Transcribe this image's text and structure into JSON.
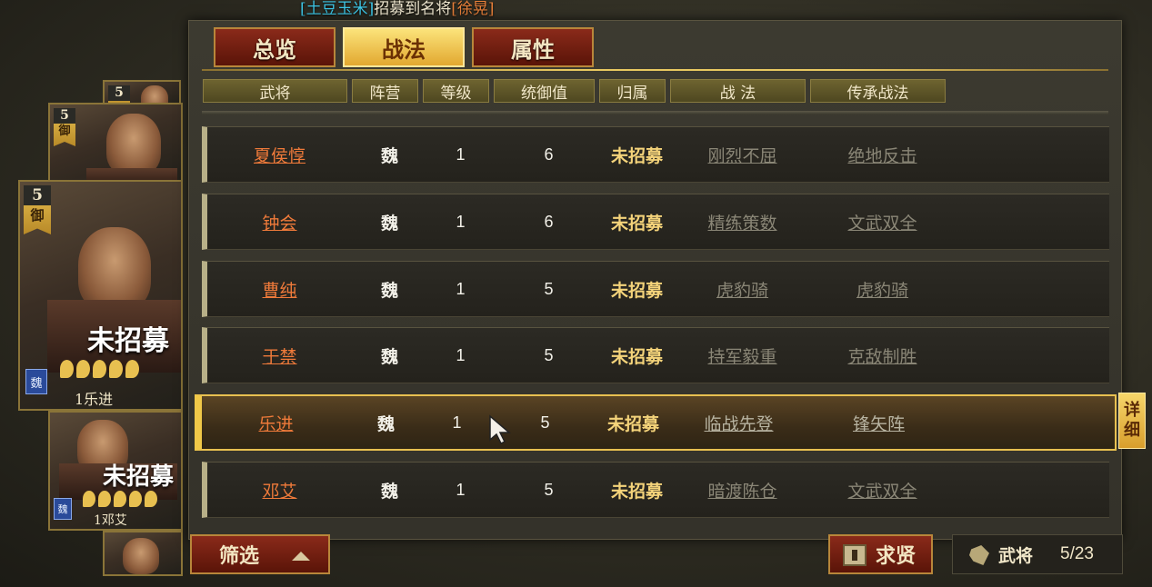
{
  "banner": {
    "player": "[土豆玉米]",
    "message": "招募到名将",
    "general": "[徐晃]"
  },
  "tabs": [
    {
      "label": "总览",
      "active": false
    },
    {
      "label": "战法",
      "active": true
    },
    {
      "label": "属性",
      "active": false
    }
  ],
  "columns": [
    "武将",
    "阵营",
    "等级",
    "统御值",
    "归属",
    "战 法",
    "传承战法"
  ],
  "rows": [
    {
      "name": "夏侯惇",
      "camp": "魏",
      "level": "1",
      "command": "6",
      "owner": "未招募",
      "skill": "刚烈不屈",
      "inherit": "绝地反击"
    },
    {
      "name": "钟会",
      "camp": "魏",
      "level": "1",
      "command": "6",
      "owner": "未招募",
      "skill": "精练策数",
      "inherit": "文武双全"
    },
    {
      "name": "曹纯",
      "camp": "魏",
      "level": "1",
      "command": "5",
      "owner": "未招募",
      "skill": "虎豹骑",
      "inherit": "虎豹骑"
    },
    {
      "name": "于禁",
      "camp": "魏",
      "level": "1",
      "command": "5",
      "owner": "未招募",
      "skill": "持军毅重",
      "inherit": "克敌制胜"
    },
    {
      "name": "乐进",
      "camp": "魏",
      "level": "1",
      "command": "5",
      "owner": "未招募",
      "skill": "临战先登",
      "inherit": "锋矢阵",
      "selected": true
    },
    {
      "name": "邓艾",
      "camp": "魏",
      "level": "1",
      "command": "5",
      "owner": "未招募",
      "skill": "暗渡陈仓",
      "inherit": "文武双全"
    }
  ],
  "detail_button": [
    "详",
    "细"
  ],
  "filter_button": "筛选",
  "seek_button": "求贤",
  "general_count": {
    "label": "武将",
    "value": "5/23"
  },
  "cards": {
    "top_small": {
      "cost": "5"
    },
    "card1": {
      "cost": "5",
      "type": "御"
    },
    "card2": {
      "cost": "5",
      "type": "御",
      "status": "未招募",
      "camp": "魏",
      "name": "1乐进",
      "stars": 5
    },
    "card3": {
      "status": "未招募",
      "camp": "魏",
      "name": "1邓艾",
      "stars": 5
    }
  },
  "colors": {
    "tab_active": "#f2c44c",
    "tab_inactive": "#7a2010",
    "name_link": "#ef7a3a",
    "owner_text": "#f4d37a",
    "selected_border": "#e8c050"
  }
}
